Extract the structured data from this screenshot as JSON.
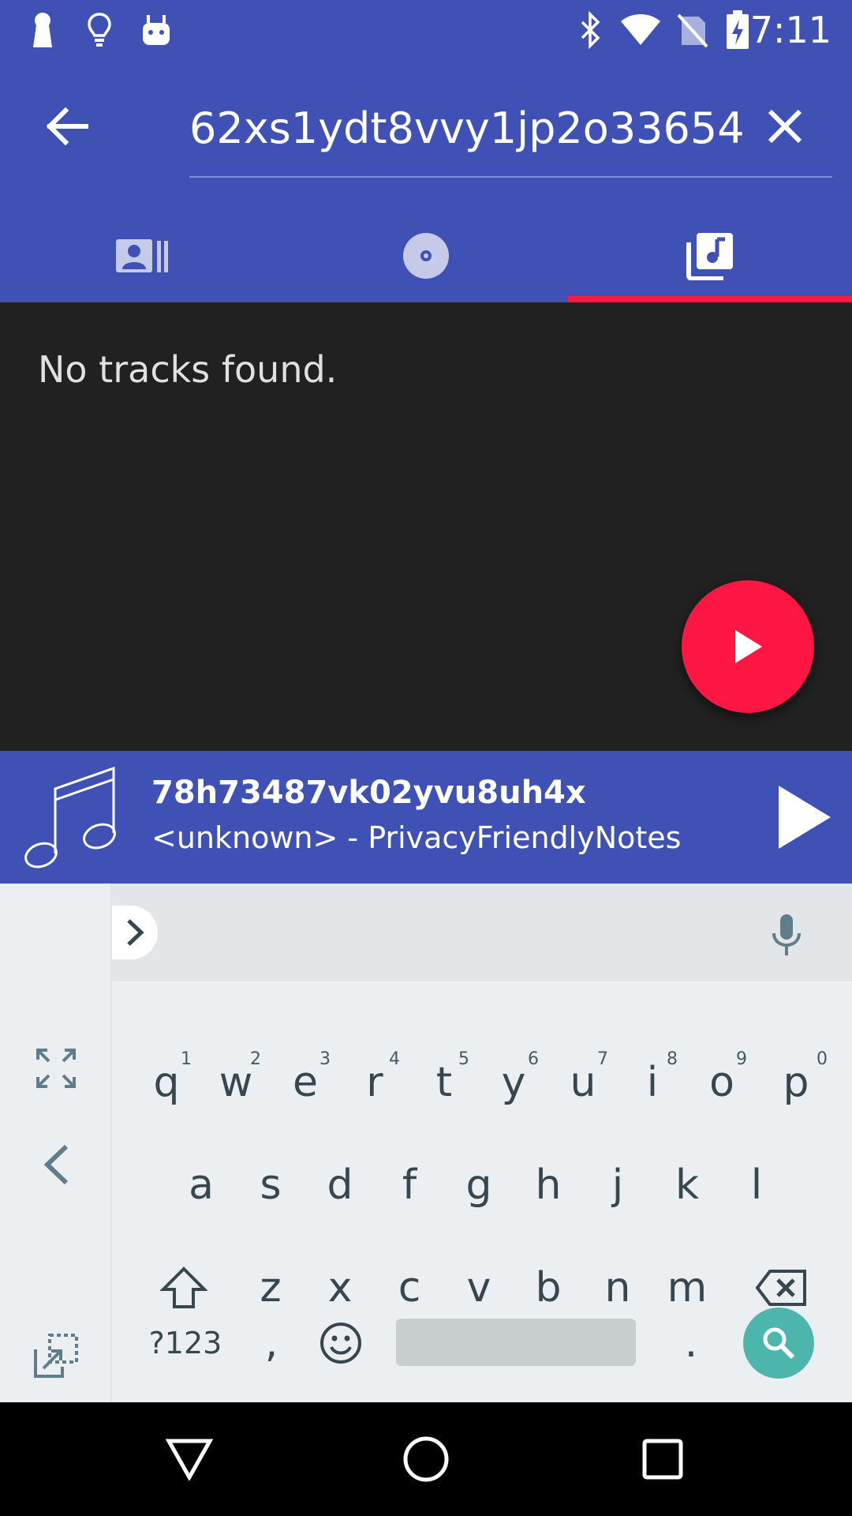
{
  "status_bar": {
    "time": "7:11",
    "icons": [
      "keyhole-icon",
      "lightbulb-icon",
      "android-icon",
      "bluetooth-icon",
      "wifi-icon",
      "no-sim-icon",
      "battery-charging-icon"
    ]
  },
  "search": {
    "query": "62xs1ydt8vvy1jp2o33654"
  },
  "tabs": [
    {
      "name": "artists",
      "icon": "artist-icon",
      "active": false
    },
    {
      "name": "albums",
      "icon": "album-icon",
      "active": false
    },
    {
      "name": "tracks",
      "icon": "music-library-icon",
      "active": true
    }
  ],
  "content": {
    "empty_message": "No tracks found."
  },
  "player": {
    "title": "78h73487vk02yvu8uh4x",
    "subtitle": "<unknown> - PrivacyFriendlyNotes"
  },
  "keyboard": {
    "row1": [
      {
        "k": "q",
        "h": "1"
      },
      {
        "k": "w",
        "h": "2"
      },
      {
        "k": "e",
        "h": "3"
      },
      {
        "k": "r",
        "h": "4"
      },
      {
        "k": "t",
        "h": "5"
      },
      {
        "k": "y",
        "h": "6"
      },
      {
        "k": "u",
        "h": "7"
      },
      {
        "k": "i",
        "h": "8"
      },
      {
        "k": "o",
        "h": "9"
      },
      {
        "k": "p",
        "h": "0"
      }
    ],
    "row2": [
      "a",
      "s",
      "d",
      "f",
      "g",
      "h",
      "j",
      "k",
      "l"
    ],
    "row3": [
      "z",
      "x",
      "c",
      "v",
      "b",
      "n",
      "m"
    ],
    "symbols_label": "?123",
    "comma": ",",
    "period": "."
  },
  "colors": {
    "primary": "#3f51b5",
    "accent": "#ff1744",
    "content_bg": "#212121",
    "keyboard_bg": "#eceff1",
    "search_key": "#4db6ac"
  }
}
